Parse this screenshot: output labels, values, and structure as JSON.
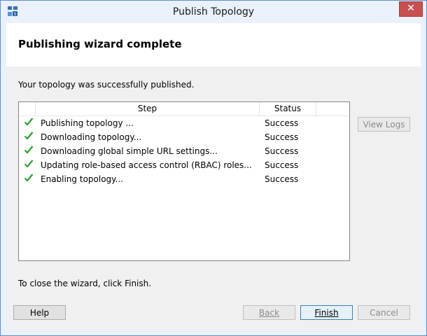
{
  "window": {
    "title": "Publish Topology",
    "close_glyph": "✕"
  },
  "header": {
    "title": "Publishing wizard complete"
  },
  "message": "Your topology was successfully published.",
  "table": {
    "columns": [
      "",
      "Step",
      "Status",
      ""
    ],
    "rows": [
      {
        "step": "Publishing topology ...",
        "status": "Success"
      },
      {
        "step": "Downloading topology...",
        "status": "Success"
      },
      {
        "step": "Downloading global simple URL settings...",
        "status": "Success"
      },
      {
        "step": "Updating role-based access control (RBAC) roles...",
        "status": "Success"
      },
      {
        "step": "Enabling topology...",
        "status": "Success"
      }
    ]
  },
  "view_logs_label": "View Logs",
  "footer_message": "To close the wizard, click Finish.",
  "buttons": {
    "help": "Help",
    "back": "Back",
    "finish": "Finish",
    "cancel": "Cancel"
  },
  "colors": {
    "accent": "#5a8ed6",
    "close": "#c75050",
    "check": "#2e9e2e"
  }
}
